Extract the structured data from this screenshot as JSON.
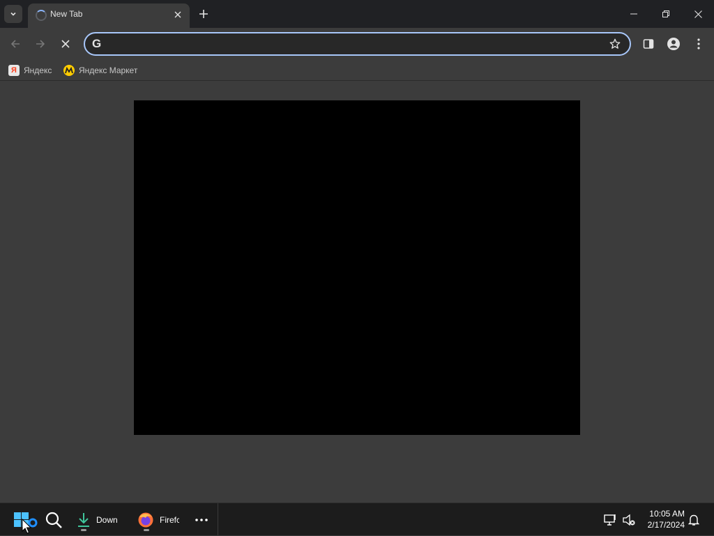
{
  "browser": {
    "tab": {
      "title": "New Tab"
    },
    "window_controls": [
      "minimize",
      "restore",
      "close"
    ],
    "omnibox": {
      "value": "",
      "placeholder": ""
    },
    "bookmarks": [
      {
        "label": "Яндекс",
        "icon": "yandex-icon"
      },
      {
        "label": "Яндекс Маркет",
        "icon": "yandex-market-icon"
      }
    ]
  },
  "taskbar": {
    "apps": [
      {
        "label": "Down",
        "icon": "download-icon"
      },
      {
        "label": "Firefc",
        "icon": "firefox-icon"
      }
    ],
    "clock": {
      "time": "10:05 AM",
      "date": "2/17/2024"
    }
  },
  "colors": {
    "accent": "#a8c7fa",
    "tab_bg": "#3c3c3c",
    "titlebar_bg": "#202124",
    "taskbar_bg": "#1c1c1c"
  }
}
